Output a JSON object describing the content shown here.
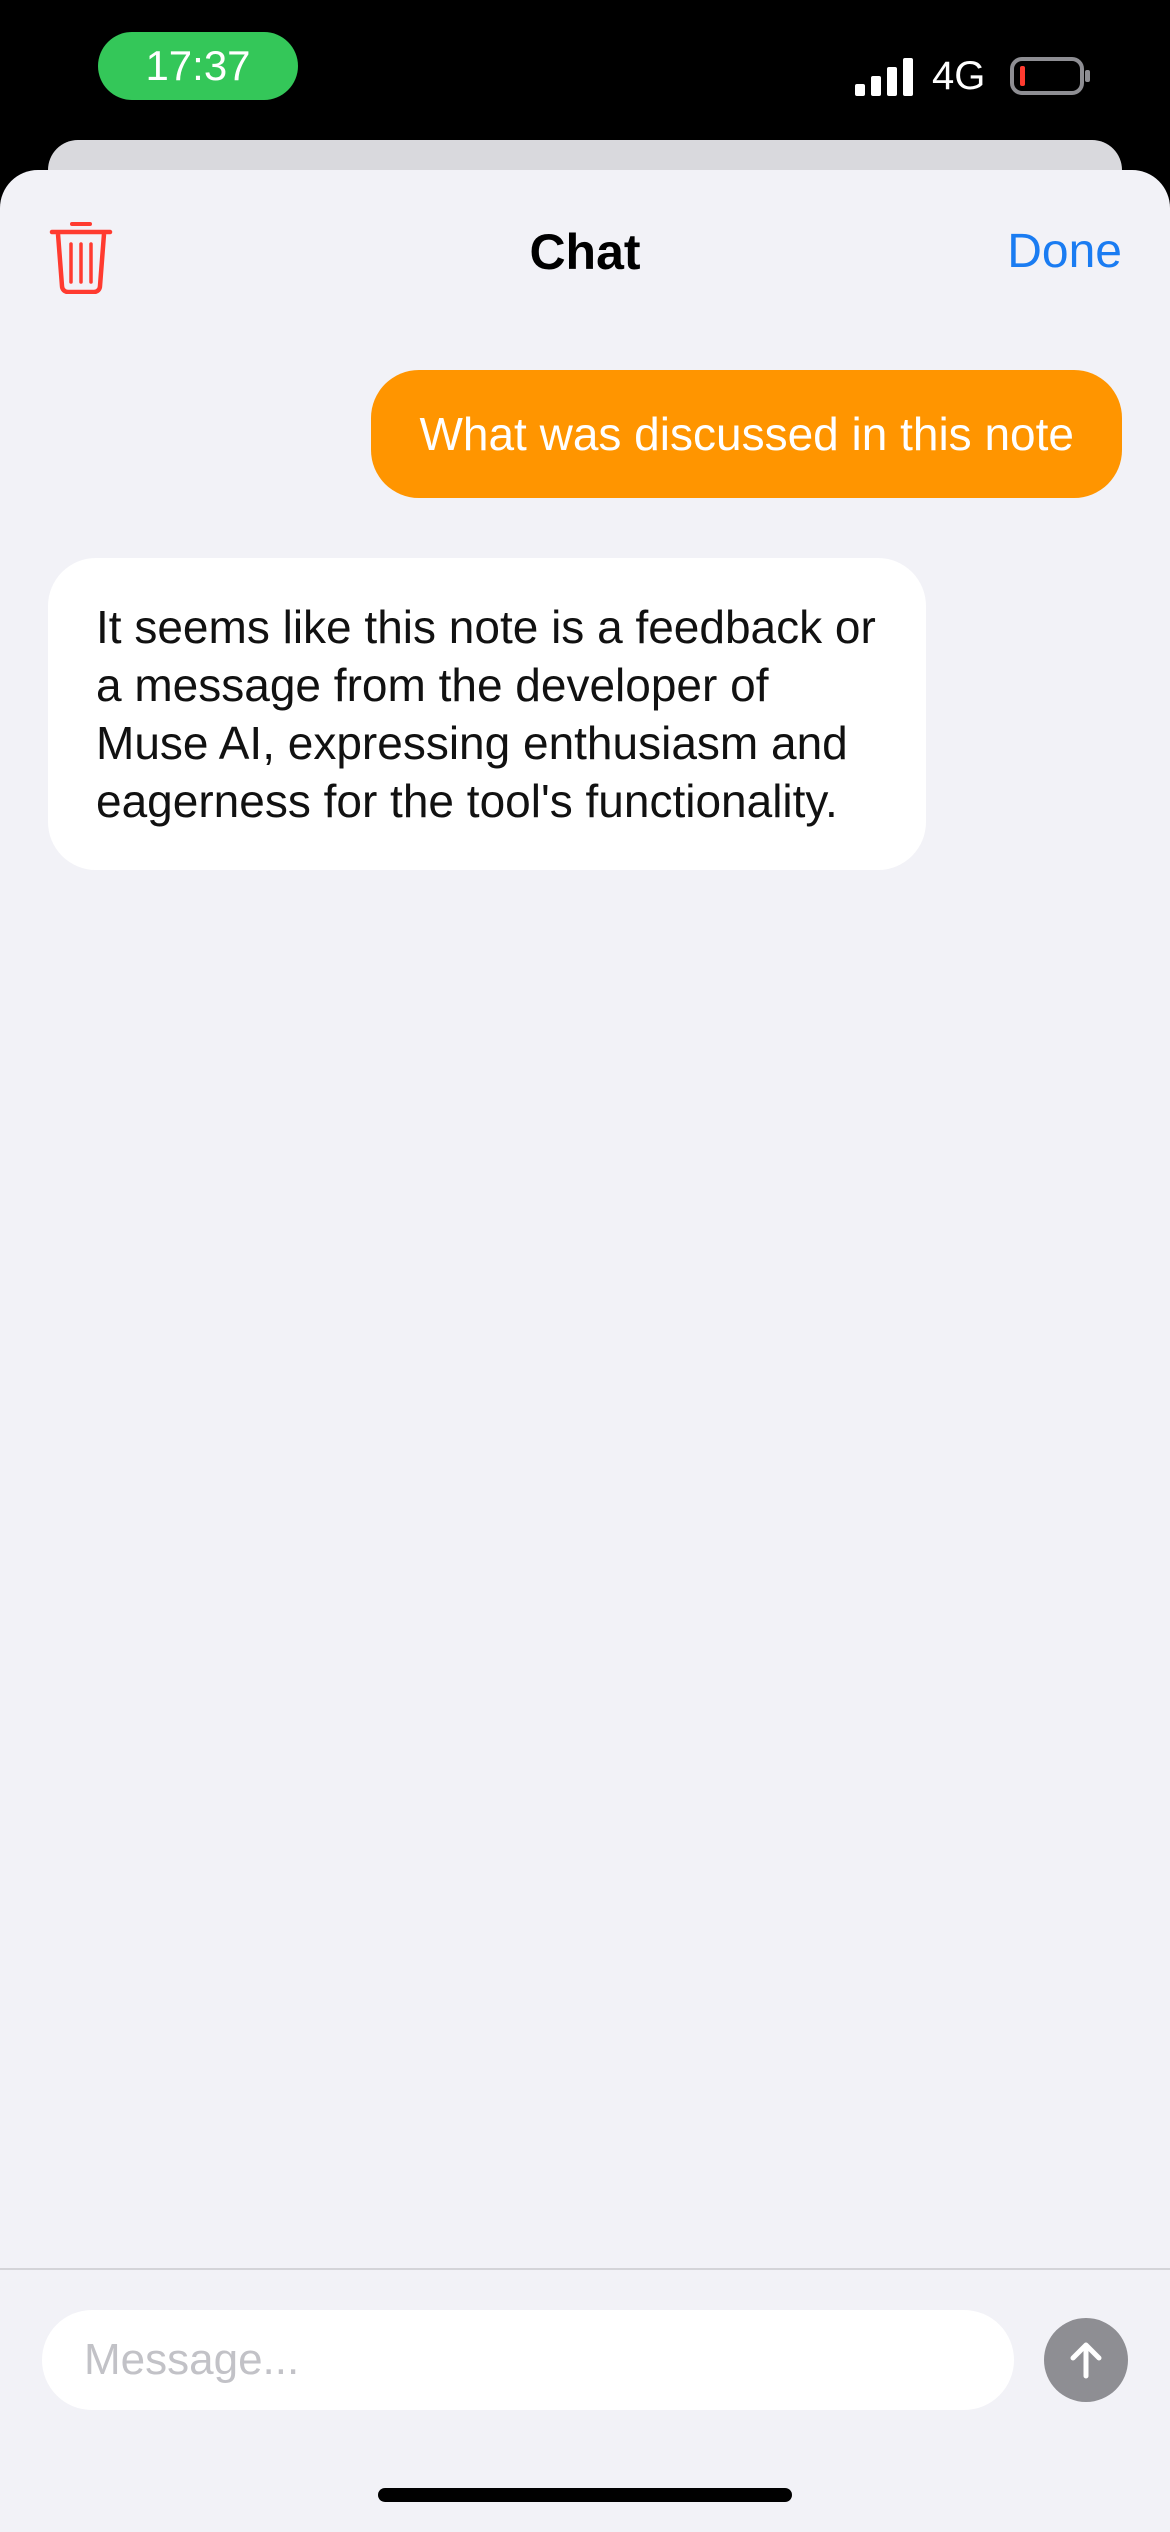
{
  "status_bar": {
    "time": "17:37",
    "network": "4G",
    "icons": [
      "signal-bars-icon",
      "battery-low-icon"
    ],
    "time_pill_color": "#34c759",
    "battery_level_color": "#ff3b30"
  },
  "nav": {
    "title": "Chat",
    "done_label": "Done",
    "trash_icon": "trash-icon",
    "accent_color": "#1a7cf2",
    "destructive_color": "#ff3b30"
  },
  "messages": [
    {
      "role": "user",
      "text": "What was discussed in this note",
      "bubble_color": "#ff9500"
    },
    {
      "role": "assistant",
      "text": "It seems like this note is a feedback or a message from the developer of Muse AI, expressing enthusiasm and eagerness for the tool's functionality.",
      "bubble_color": "#ffffff"
    }
  ],
  "composer": {
    "placeholder": "Message...",
    "value": "",
    "send_icon": "arrow-up-icon"
  }
}
